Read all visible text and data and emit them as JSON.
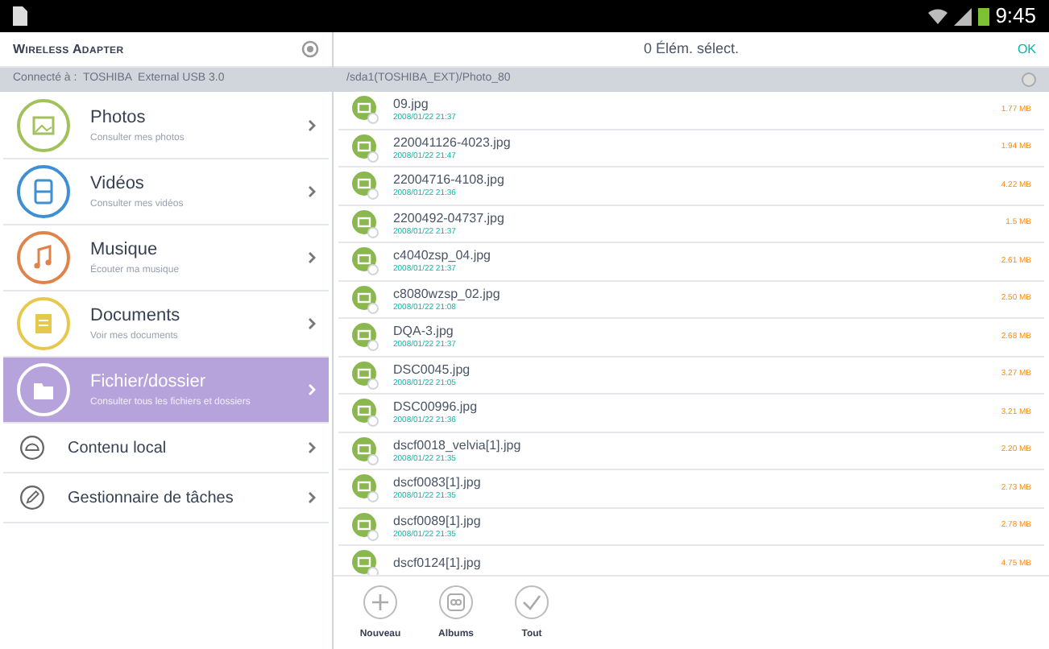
{
  "status_bar": {
    "time": "9:45"
  },
  "sidebar": {
    "title": "Wireless Adapter",
    "connection": "Connecté à :  TOSHIBA  External USB 3.0",
    "items": [
      {
        "kind": "category",
        "color": "#a3c15a",
        "title": "Photos",
        "subtitle": "Consulter mes photos",
        "selected": false
      },
      {
        "kind": "category",
        "color": "#3f8fd2",
        "title": "Vidéos",
        "subtitle": "Consulter mes vidéos",
        "selected": false
      },
      {
        "kind": "category",
        "color": "#e0834a",
        "title": "Musique",
        "subtitle": "Écouter ma musique",
        "selected": false
      },
      {
        "kind": "category",
        "color": "#e6c84a",
        "title": "Documents",
        "subtitle": "Voir mes documents",
        "selected": false
      },
      {
        "kind": "category",
        "color": "#b7a3dc",
        "title": "Fichier/dossier",
        "subtitle": "Consulter tous les fichiers et dossiers",
        "selected": true
      },
      {
        "kind": "tool",
        "title": "Contenu local",
        "selected": false
      },
      {
        "kind": "tool",
        "title": "Gestionnaire de tâches",
        "selected": false
      }
    ]
  },
  "main": {
    "title": "0 Élém. sélect.",
    "ok": "OK",
    "path": "/sda1(TOSHIBA_EXT)/Photo_80",
    "files": [
      {
        "name": "09.jpg",
        "date": "2008/01/22 21:37",
        "size": "1.77 MB",
        "checked": false
      },
      {
        "name": "220041126-4023.jpg",
        "date": "2008/01/22 21:47",
        "size": "1.94 MB",
        "checked": false
      },
      {
        "name": "22004716-4108.jpg",
        "date": "2008/01/22 21:36",
        "size": "4.22 MB",
        "checked": false
      },
      {
        "name": "2200492-04737.jpg",
        "date": "2008/01/22 21:37",
        "size": "1.5 MB",
        "checked": false
      },
      {
        "name": "c4040zsp_04.jpg",
        "date": "2008/01/22 21:37",
        "size": "2.61 MB",
        "checked": false
      },
      {
        "name": "c8080wzsp_02.jpg",
        "date": "2008/01/22 21:08",
        "size": "2.50 MB",
        "checked": false
      },
      {
        "name": "DQA-3.jpg",
        "date": "2008/01/22 21:37",
        "size": "2.68 MB",
        "checked": false
      },
      {
        "name": "DSC0045.jpg",
        "date": "2008/01/22 21:05",
        "size": "3.27 MB",
        "checked": false
      },
      {
        "name": "DSC00996.jpg",
        "date": "2008/01/22 21:36",
        "size": "3.21 MB",
        "checked": false
      },
      {
        "name": "dscf0018_velvia[1].jpg",
        "date": "2008/01/22 21:35",
        "size": "2.20 MB",
        "checked": false
      },
      {
        "name": "dscf0083[1].jpg",
        "date": "2008/01/22 21:35",
        "size": "2.73 MB",
        "checked": false
      },
      {
        "name": "dscf0089[1].jpg",
        "date": "2008/01/22 21:35",
        "size": "2.78 MB",
        "checked": false
      },
      {
        "name": "dscf0124[1].jpg",
        "size": "4.75 MB",
        "checked": false
      }
    ],
    "toolbar": [
      {
        "label": "Nouveau"
      },
      {
        "label": "Albums"
      },
      {
        "label": "Tout"
      }
    ]
  }
}
